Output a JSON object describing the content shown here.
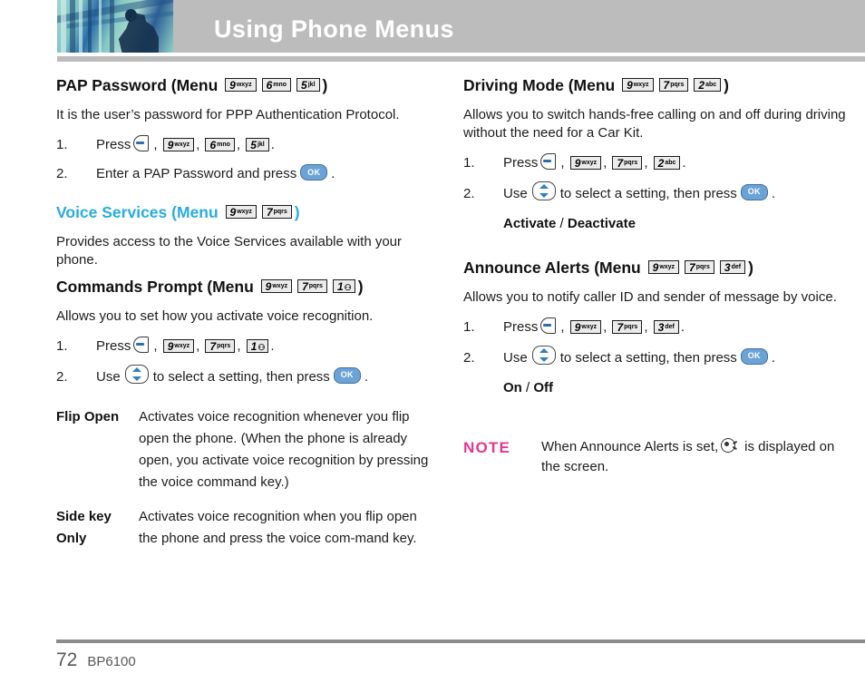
{
  "header": {
    "title": "Using Phone Menus",
    "photo_alt": "abstract-blue-architecture-photo"
  },
  "left_column": {
    "sections": [
      {
        "id": "pap-password",
        "heading_prefix": "PAP Password (Menu",
        "heading_suffix": ")",
        "heading_color": "#111111",
        "keys": [
          {
            "digit": "9",
            "letters": "wxyz"
          },
          {
            "digit": "6",
            "letters": "mno"
          },
          {
            "digit": "5",
            "letters": "jkl"
          }
        ],
        "body": "It is the user’s password for PPP Authentication Protocol.",
        "steps": [
          {
            "num": "1.",
            "lead": "Press",
            "icon": "softkey",
            "keys": [
              {
                "digit": "9",
                "letters": "wxyz"
              },
              {
                "digit": "6",
                "letters": "mno"
              },
              {
                "digit": "5",
                "letters": "jkl"
              }
            ],
            "tail": "."
          },
          {
            "num": "2.",
            "lead": "Enter a PAP Password and press",
            "icon": "okkey",
            "ok_label": "OK",
            "tail": "."
          }
        ]
      },
      {
        "id": "voice-services",
        "heading_prefix": "Voice Services (Menu",
        "heading_suffix": ")",
        "heading_color": "#29abe2",
        "keys": [
          {
            "digit": "9",
            "letters": "wxyz"
          },
          {
            "digit": "7",
            "letters": "pqrs"
          }
        ],
        "body": "Provides access to the Voice Services available with your phone."
      },
      {
        "id": "commands-prompt",
        "heading_prefix": "Commands Prompt (Menu",
        "heading_suffix": ")",
        "heading_color": "#111111",
        "keys": [
          {
            "digit": "9",
            "letters": "wxyz"
          },
          {
            "digit": "7",
            "letters": "pqrs"
          },
          {
            "digit": "1",
            "letters": "⚇",
            "voicemail": true
          }
        ],
        "body": "Allows you to set how you activate voice recognition.",
        "steps": [
          {
            "num": "1.",
            "lead": "Press",
            "icon": "softkey",
            "keys": [
              {
                "digit": "9",
                "letters": "wxyz"
              },
              {
                "digit": "7",
                "letters": "pqrs"
              },
              {
                "digit": "1",
                "letters": "⚇",
                "voicemail": true
              }
            ],
            "tail": "."
          },
          {
            "num": "2.",
            "lead": "Use",
            "icon": "navkey",
            "mid": "to select a setting, then press",
            "ok_label": "OK",
            "tail": "."
          }
        ],
        "definitions": [
          {
            "term": "Flip Open",
            "desc": "Activates voice recognition whenever you flip open the phone. (When the phone is already open, you activate voice recognition by pressing the voice command key.)"
          },
          {
            "term": "Side key Only",
            "desc": "Activates voice recognition when you flip open the phone and press the voice com-mand key."
          }
        ]
      }
    ]
  },
  "right_column": {
    "sections": [
      {
        "id": "driving-mode",
        "heading_prefix": "Driving Mode (Menu",
        "heading_suffix": ")",
        "heading_color": "#111111",
        "keys": [
          {
            "digit": "9",
            "letters": "wxyz"
          },
          {
            "digit": "7",
            "letters": "pqrs"
          },
          {
            "digit": "2",
            "letters": "abc"
          }
        ],
        "body": "Allows you to switch hands-free calling on and off during driving without the need for a Car Kit.",
        "steps": [
          {
            "num": "1.",
            "lead": "Press",
            "icon": "softkey",
            "keys": [
              {
                "digit": "9",
                "letters": "wxyz"
              },
              {
                "digit": "7",
                "letters": "pqrs"
              },
              {
                "digit": "2",
                "letters": "abc"
              }
            ],
            "tail": "."
          },
          {
            "num": "2.",
            "lead": "Use",
            "icon": "navkey",
            "mid": "to select a setting, then press",
            "ok_label": "OK",
            "tail": "."
          }
        ],
        "options": {
          "first": "Activate",
          "sep": " / ",
          "second": "Deactivate"
        }
      },
      {
        "id": "announce-alerts",
        "heading_prefix": "Announce Alerts (Menu",
        "heading_suffix": ")",
        "heading_color": "#111111",
        "keys": [
          {
            "digit": "9",
            "letters": "wxyz"
          },
          {
            "digit": "7",
            "letters": "pqrs"
          },
          {
            "digit": "3",
            "letters": "def"
          }
        ],
        "body": "Allows you to notify caller ID and sender of message by voice.",
        "steps": [
          {
            "num": "1.",
            "lead": "Press",
            "icon": "softkey",
            "keys": [
              {
                "digit": "9",
                "letters": "wxyz"
              },
              {
                "digit": "7",
                "letters": "pqrs"
              },
              {
                "digit": "3",
                "letters": "def"
              }
            ],
            "tail": "."
          },
          {
            "num": "2.",
            "lead": "Use",
            "icon": "navkey",
            "mid": "to select a setting, then press",
            "ok_label": "OK",
            "tail": "."
          }
        ],
        "options": {
          "first": "On",
          "sep": " / ",
          "second": "Off"
        }
      }
    ],
    "note": {
      "label": "NOTE",
      "text_before": "When Announce Alerts is set,",
      "icon": "announce-alerts-indicator-icon",
      "text_after": "is displayed on the screen."
    }
  },
  "footer": {
    "page_number": "72",
    "model": "BP6100"
  },
  "colors": {
    "accent_blue": "#29abe2",
    "note_pink": "#e2388f",
    "header_gray": "#bcbcbc",
    "key_blue": "#6ba3d6"
  }
}
